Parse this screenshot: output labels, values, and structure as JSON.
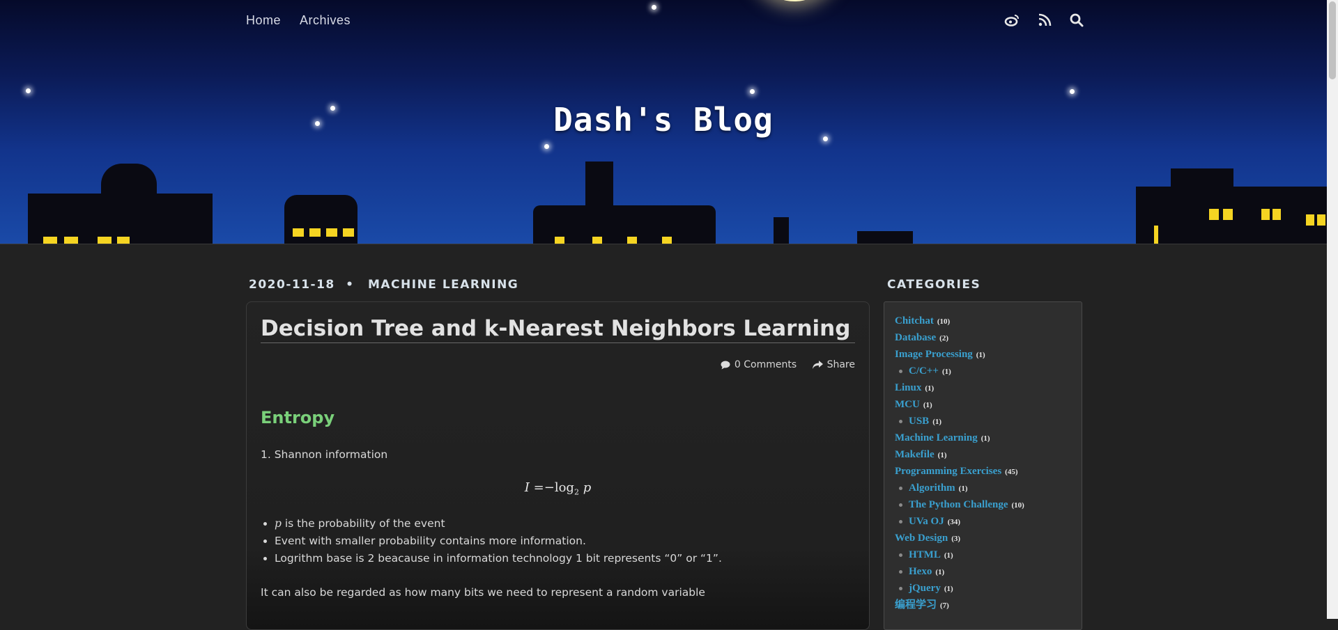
{
  "nav": {
    "links": [
      "Home",
      "Archives"
    ],
    "icons": [
      "weibo-icon",
      "rss-icon",
      "search-icon"
    ]
  },
  "site": {
    "title": "Dash's Blog"
  },
  "post": {
    "date": "2020-11-18",
    "separator": "•",
    "category": "MACHINE LEARNING",
    "title": "Decision Tree and k-Nearest Neighbors Learning",
    "comments_label": "0 Comments",
    "share_label": "Share",
    "section_heading": "Entropy",
    "item_1": "1. Shannon information",
    "formula": {
      "lhs": "I",
      "eq": "=",
      "minus": "−",
      "log": "log",
      "base": "2",
      "var": "p"
    },
    "bullet_var": "p",
    "bullets": [
      " is the probability of the event",
      "Event with smaller probability contains more information.",
      "Logrithm base is 2 beacause in information technology 1 bit represents “0” or “1”."
    ],
    "paragraph": "It can also be regarded as how many bits we need to represent a random variable"
  },
  "sidebar": {
    "title": "CATEGORIES",
    "categories": [
      {
        "label": "Chitchat",
        "count": "(10)",
        "level": 0
      },
      {
        "label": "Database",
        "count": "(2)",
        "level": 0
      },
      {
        "label": "Image Processing",
        "count": "(1)",
        "level": 0
      },
      {
        "label": "C/C++",
        "count": "(1)",
        "level": 1
      },
      {
        "label": "Linux",
        "count": "(1)",
        "level": 0
      },
      {
        "label": "MCU",
        "count": "(1)",
        "level": 0
      },
      {
        "label": "USB",
        "count": "(1)",
        "level": 1
      },
      {
        "label": "Machine Learning",
        "count": "(1)",
        "level": 0
      },
      {
        "label": "Makefile",
        "count": "(1)",
        "level": 0
      },
      {
        "label": "Programming Exercises",
        "count": "(45)",
        "level": 0
      },
      {
        "label": "Algorithm",
        "count": "(1)",
        "level": 1
      },
      {
        "label": "The Python Challenge",
        "count": "(10)",
        "level": 1
      },
      {
        "label": "UVa OJ",
        "count": "(34)",
        "level": 1
      },
      {
        "label": "Web Design",
        "count": "(3)",
        "level": 0
      },
      {
        "label": "HTML",
        "count": "(1)",
        "level": 1
      },
      {
        "label": "Hexo",
        "count": "(1)",
        "level": 1
      },
      {
        "label": "jQuery",
        "count": "(1)",
        "level": 1
      },
      {
        "label": "编程学习",
        "count": "(7)",
        "level": 0
      }
    ]
  },
  "colors": {
    "accent_link": "#3aa0cf",
    "heading_green": "#7ad07a",
    "background": "#222222",
    "window_light": "#f5d422"
  }
}
